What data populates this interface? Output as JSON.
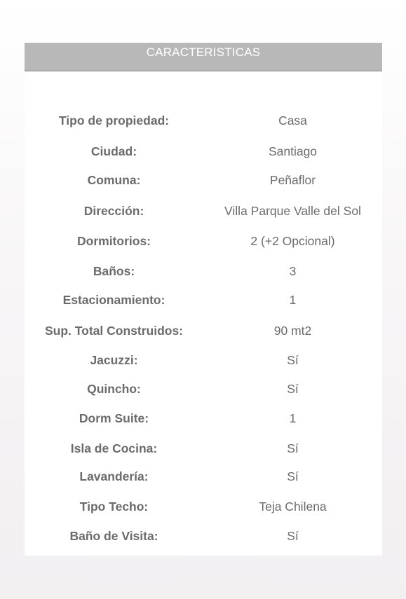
{
  "section": {
    "title": "CARACTERISTICAS"
  },
  "features": [
    {
      "label": "Tipo de propiedad:",
      "value": "Casa"
    },
    {
      "label": "Ciudad:",
      "value": "Santiago"
    },
    {
      "label": "Comuna:",
      "value": "Peñaflor"
    },
    {
      "label": "Dirección:",
      "value": "Villa Parque Valle del Sol"
    },
    {
      "label": "Dormitorios:",
      "value": "2 (+2 Opcional)"
    },
    {
      "label": "Baños:",
      "value": "3"
    },
    {
      "label": "Estacionamiento:",
      "value": "1"
    },
    {
      "label": "Sup. Total Construidos:",
      "value": "90 mt2"
    },
    {
      "label": "Jacuzzi:",
      "value": "Sí"
    },
    {
      "label": "Quincho:",
      "value": "Sí"
    },
    {
      "label": "Dorm Suite:",
      "value": "1"
    },
    {
      "label": "Isla de Cocina:",
      "value": "Sí"
    },
    {
      "label": "Lavandería:",
      "value": "Sí"
    },
    {
      "label": "Tipo Techo:",
      "value": "Teja Chilena"
    },
    {
      "label": "Baño de Visita:",
      "value": "Sí"
    }
  ]
}
